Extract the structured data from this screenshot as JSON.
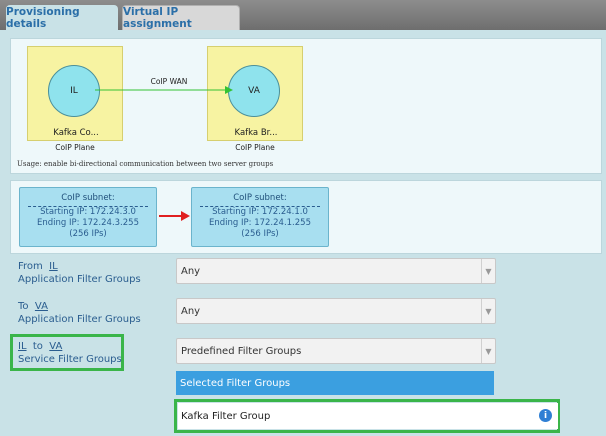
{
  "tabs": [
    {
      "label": "Provisioning details",
      "active": true
    },
    {
      "label": "Virtual IP assignment",
      "active": false
    }
  ],
  "diagram": {
    "left_node": {
      "circle_label": "IL",
      "name": "Kafka Co...",
      "plane": "CoIP Plane"
    },
    "right_node": {
      "circle_label": "VA",
      "name": "Kafka Br...",
      "plane": "CoIP Plane"
    },
    "link_label": "CoIP WAN",
    "link_color": "#34c234",
    "usage": "Usage: enable bi-directional communication between two server groups"
  },
  "subnets": [
    {
      "title": "CoIP subnet:",
      "start": "Starting IP: 172.24.3.0",
      "end": "Ending IP: 172.24.3.255",
      "count": "(256 IPs)"
    },
    {
      "title": "CoIP subnet:",
      "start": "Starting IP: 172.24.1.0",
      "end": "Ending IP: 172.24.1.255",
      "count": "(256 IPs)"
    }
  ],
  "arrow_color": "#e02020",
  "filters": {
    "from": {
      "prefix": "From",
      "group": "IL",
      "label": "Application Filter Groups",
      "value": "Any"
    },
    "to": {
      "prefix": "To",
      "group": "VA",
      "label": "Application Filter Groups",
      "value": "Any"
    },
    "service": {
      "from": "IL",
      "conj": "to",
      "to": "VA",
      "label": "Service Filter Groups",
      "value": "Predefined Filter Groups"
    }
  },
  "selected_header": "Selected Filter Groups",
  "selected_items": [
    "Kafka Filter Group"
  ],
  "highlight_color": "#3ab54a",
  "icons": {
    "caret": "chevron-down-icon",
    "info": "info-icon"
  }
}
